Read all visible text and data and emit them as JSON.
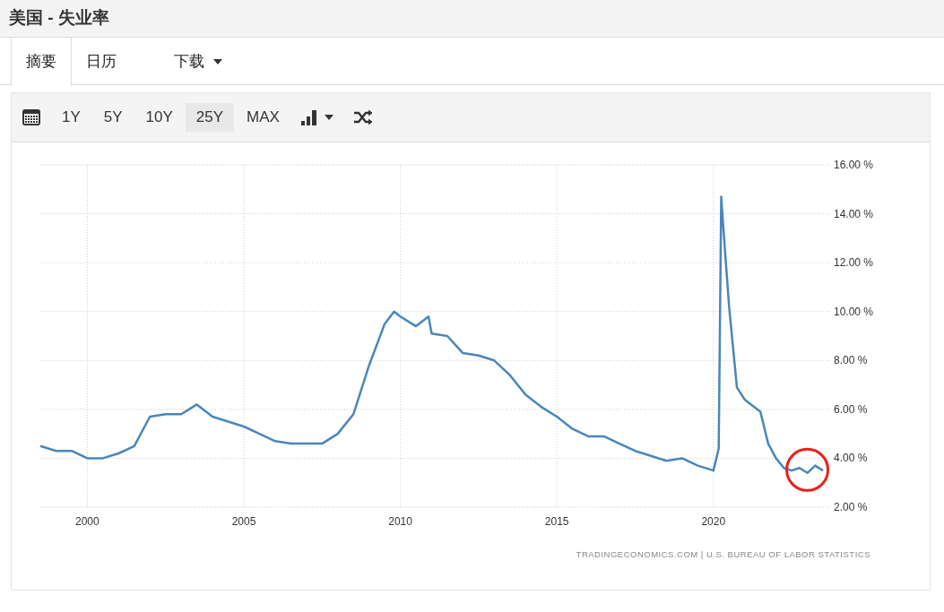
{
  "title": "美国 - 失业率",
  "tabs": [
    {
      "label": "摘要",
      "selected": true,
      "kind": "tab"
    },
    {
      "label": "日历",
      "selected": false,
      "kind": "tab"
    },
    {
      "label": "下载",
      "selected": false,
      "kind": "dropdown"
    }
  ],
  "range_buttons": [
    {
      "label": "1Y",
      "selected": false
    },
    {
      "label": "5Y",
      "selected": false
    },
    {
      "label": "10Y",
      "selected": false
    },
    {
      "label": "25Y",
      "selected": true
    },
    {
      "label": "MAX",
      "selected": false
    }
  ],
  "chart": {
    "source": "TRADINGECONOMICS.COM | U.S. BUREAU OF LABOR STATISTICS",
    "chart_data": {
      "type": "line",
      "x": [
        1998.5,
        1999,
        1999.5,
        2000,
        2000.5,
        2001,
        2001.5,
        2002,
        2002.5,
        2003,
        2003.5,
        2004,
        2004.5,
        2005,
        2005.5,
        2006,
        2006.5,
        2007,
        2007.5,
        2008,
        2008.5,
        2009,
        2009.5,
        2009.8,
        2010,
        2010.5,
        2010.9,
        2011,
        2011.5,
        2012,
        2012.5,
        2013,
        2013.5,
        2014,
        2014.5,
        2015,
        2015.5,
        2016,
        2016.5,
        2017,
        2017.5,
        2018,
        2018.5,
        2019,
        2019.5,
        2020,
        2020.17,
        2020.25,
        2020.33,
        2020.5,
        2020.75,
        2021,
        2021.5,
        2021.75,
        2022,
        2022.25,
        2022.5,
        2022.75,
        2023,
        2023.25,
        2023.5
      ],
      "series": [
        {
          "color": "#4a86bb",
          "values": [
            4.5,
            4.3,
            4.3,
            4.0,
            4.0,
            4.2,
            4.5,
            5.7,
            5.8,
            5.8,
            6.2,
            5.7,
            5.5,
            5.3,
            5.0,
            4.7,
            4.6,
            4.6,
            4.6,
            5.0,
            5.8,
            7.8,
            9.5,
            10.0,
            9.8,
            9.4,
            9.8,
            9.1,
            9.0,
            8.3,
            8.2,
            8.0,
            7.4,
            6.6,
            6.1,
            5.7,
            5.2,
            4.9,
            4.9,
            4.6,
            4.3,
            4.1,
            3.9,
            4.0,
            3.7,
            3.5,
            4.4,
            14.7,
            13.2,
            10.2,
            6.9,
            6.4,
            5.9,
            4.6,
            4.0,
            3.6,
            3.5,
            3.6,
            3.4,
            3.7,
            3.5
          ]
        }
      ],
      "grid": true,
      "xlim": [
        1998.5,
        2023.7
      ],
      "ylim": [
        2,
        16
      ],
      "xticks": [
        2000,
        2005,
        2010,
        2015,
        2020
      ],
      "yticks": [
        {
          "value": 2,
          "label": "2.00 %"
        },
        {
          "value": 4,
          "label": "4.00 %"
        },
        {
          "value": 6,
          "label": "6.00 %"
        },
        {
          "value": 8,
          "label": "8.00 %"
        },
        {
          "value": 10,
          "label": "10.00 %"
        },
        {
          "value": 12,
          "label": "12.00 %"
        },
        {
          "value": 14,
          "label": "14.00 %"
        },
        {
          "value": 16,
          "label": "16.00 %"
        }
      ]
    }
  }
}
